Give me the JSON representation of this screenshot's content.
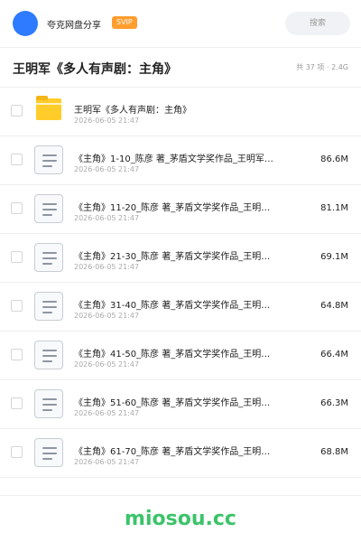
{
  "header": {
    "share_name": "夸克网盘分享",
    "badge": "SVIP",
    "search_placeholder": "搜索",
    "avatar_color": "#2f7bff",
    "badge_color": "#ff9d2e"
  },
  "page": {
    "title": "王明军《多人有声剧：主角》",
    "meta": "共 37 项 · 2.4G"
  },
  "files": [
    {
      "type": "folder",
      "name": "王明军《多人有声剧：主角》",
      "date": "2026-06-05 21:47",
      "size": ""
    },
    {
      "type": "doc",
      "name": "《主角》1-10_陈彦 著_茅盾文学奖作品_王明军…",
      "date": "2026-06-05 21:47",
      "size": "86.6M"
    },
    {
      "type": "doc",
      "name": "《主角》11-20_陈彦 著_茅盾文学奖作品_王明…",
      "date": "2026-06-05 21:47",
      "size": "81.1M"
    },
    {
      "type": "doc",
      "name": "《主角》21-30_陈彦 著_茅盾文学奖作品_王明…",
      "date": "2026-06-05 21:47",
      "size": "69.1M"
    },
    {
      "type": "doc",
      "name": "《主角》31-40_陈彦 著_茅盾文学奖作品_王明…",
      "date": "2026-06-05 21:47",
      "size": "64.8M"
    },
    {
      "type": "doc",
      "name": "《主角》41-50_陈彦 著_茅盾文学奖作品_王明…",
      "date": "2026-06-05 21:47",
      "size": "66.4M"
    },
    {
      "type": "doc",
      "name": "《主角》51-60_陈彦 著_茅盾文学奖作品_王明…",
      "date": "2026-06-05 21:47",
      "size": "66.3M"
    },
    {
      "type": "doc",
      "name": "《主角》61-70_陈彦 著_茅盾文学奖作品_王明…",
      "date": "2026-06-05 21:47",
      "size": "68.8M"
    }
  ],
  "watermark": "miosou.cc"
}
